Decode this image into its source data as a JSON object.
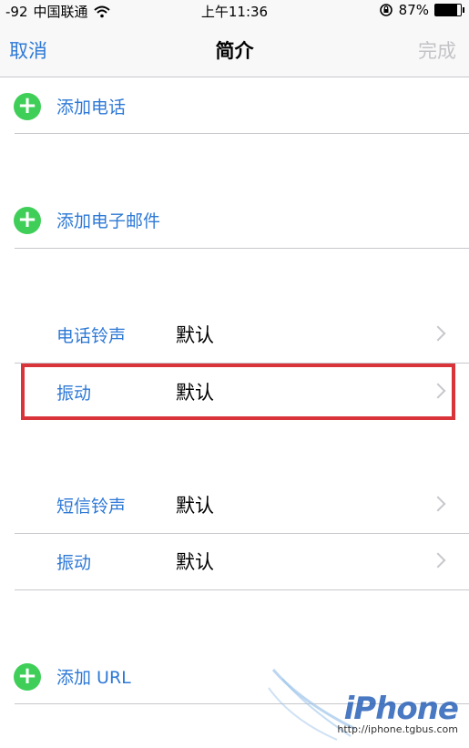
{
  "status_bar": {
    "signal": "-92",
    "carrier": "中国联通",
    "time": "上午11:36",
    "battery_percent": "87%",
    "battery_level": 0.87
  },
  "nav": {
    "cancel_label": "取消",
    "title": "简介",
    "done_label": "完成"
  },
  "add_phone_label": "添加电话",
  "add_email_label": "添加电子邮件",
  "ringtone_section": {
    "ringtone": {
      "label": "电话铃声",
      "value": "默认"
    },
    "vibration": {
      "label": "振动",
      "value": "默认"
    }
  },
  "text_tone_section": {
    "text_tone": {
      "label": "短信铃声",
      "value": "默认"
    },
    "vibration": {
      "label": "振动",
      "value": "默认"
    }
  },
  "add_url_label": "添加 URL",
  "watermark": {
    "brand": "iPhone",
    "url": "http://iphone.tgbus.com"
  },
  "colors": {
    "accent": "#2e79d6",
    "add_green": "#3fcf58",
    "highlight_red": "#d8343a",
    "separator": "#c8c7cc"
  },
  "icons": [
    "wifi-icon",
    "rotation-lock-icon",
    "battery-icon",
    "add-icon",
    "chevron-right-icon"
  ]
}
